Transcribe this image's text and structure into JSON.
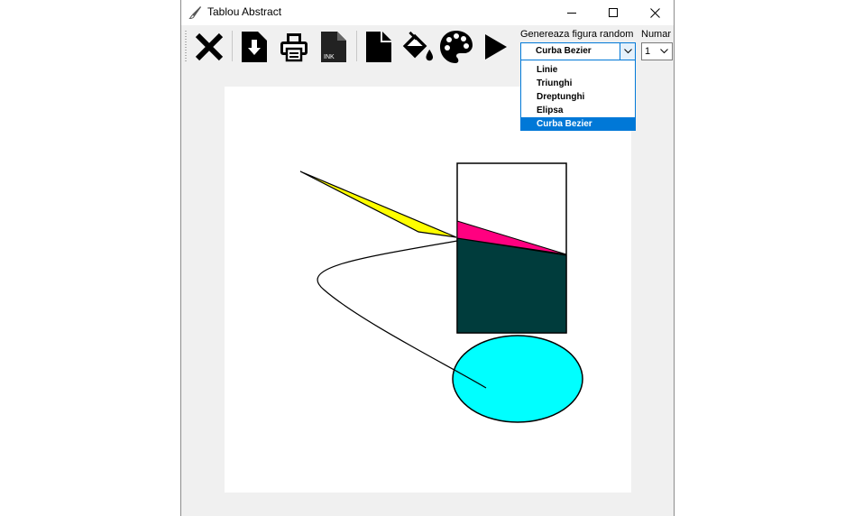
{
  "window": {
    "title": "Tablou Abstract",
    "controls": [
      "minimize",
      "maximize",
      "close"
    ]
  },
  "toolbar": {
    "tools": [
      {
        "name": "close-tool",
        "icon": "x-icon"
      },
      {
        "name": "save-tool",
        "icon": "download-file-icon"
      },
      {
        "name": "print-tool",
        "icon": "printer-icon"
      },
      {
        "name": "ink-tool",
        "icon": "ink-file-icon",
        "text": "INK"
      },
      {
        "name": "new-file-tool",
        "icon": "file-icon"
      },
      {
        "name": "fill-tool",
        "icon": "paint-bucket-icon"
      },
      {
        "name": "palette-tool",
        "icon": "palette-icon"
      },
      {
        "name": "play-tool",
        "icon": "play-icon"
      }
    ],
    "shape_label": "Genereaza figura random",
    "shape_selected": "Curba Bezier",
    "count_label": "Numar",
    "count_selected": "1"
  },
  "dropdown": {
    "options": [
      "Linie",
      "Triunghi",
      "Dreptunghi",
      "Elipsa",
      "Curba Bezier"
    ],
    "highlighted_index": 4
  },
  "canvas": {
    "background": "#ffffff",
    "shapes": [
      {
        "type": "polygon",
        "fill": "#ffff00",
        "description": "triangle"
      },
      {
        "type": "rectangle",
        "fill": "#ffffff"
      },
      {
        "type": "polygon",
        "fill": "#ff0080"
      },
      {
        "type": "polygon",
        "fill": "#003c3c"
      },
      {
        "type": "ellipse",
        "fill": "#00ffff"
      },
      {
        "type": "bezier-curve",
        "stroke": "#000000"
      }
    ]
  },
  "colors": {
    "accent": "#0078d7",
    "window_bg": "#f0f0f0"
  }
}
